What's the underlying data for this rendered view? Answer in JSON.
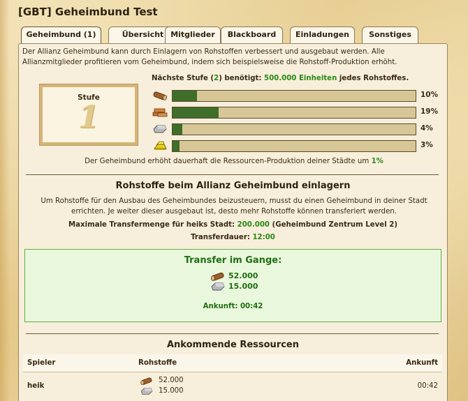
{
  "window": {
    "title": "[GBT] Geheimbund Test"
  },
  "tabs": [
    {
      "label": "Geheimbund (1)",
      "active": true
    },
    {
      "label": "Übersicht"
    },
    {
      "label": "Mitglieder"
    },
    {
      "label": "Blackboard"
    },
    {
      "label": "Einladungen"
    },
    {
      "label": "Sonstiges"
    }
  ],
  "intro": {
    "description": "Der Allianz Geheimbund kann durch Einlagern von Rohstoffen verbessert und ausgebaut werden. Alle Allianzmitglieder profitieren vom Geheimbund, indem sich beispielsweise die Rohstoff-Produktion erhöht."
  },
  "next_level": {
    "prefix": "Nächste Stufe (",
    "level": "2",
    "mid": ") benötigt: ",
    "amount": "500.000 Einheiten",
    "suffix": " jedes Rohstoffes."
  },
  "stufe": {
    "label": "Stufe",
    "value": "1"
  },
  "resources": [
    {
      "icon": "wood-icon",
      "progress": 0.1,
      "percent_label": "10%"
    },
    {
      "icon": "brick-icon",
      "progress": 0.19,
      "percent_label": "19%"
    },
    {
      "icon": "stone-icon",
      "progress": 0.04,
      "percent_label": "4%"
    },
    {
      "icon": "gold-icon",
      "progress": 0.03,
      "percent_label": "3%"
    }
  ],
  "bonus": {
    "prefix": "Der Geheimbund erhöht dauerhaft die Ressourcen-Produktion deiner Städte um ",
    "value": "1%"
  },
  "deposit": {
    "title": "Rohstoffe beim Allianz Geheimbund einlagern",
    "text": "Um Rohstoffe für den Ausbau des Geheimbundes beizusteuern, musst du einen Geheimbund in deiner Stadt errichten. Je weiter dieser ausgebaut ist, desto mehr Rohstoffe können transferiert werden.",
    "max_label": "Maximale Transfermenge für heiks Stadt: ",
    "max_value": "200.000",
    "max_suffix": " (Geheimbund Zentrum Level 2)",
    "duration_label": "Transferdauer: ",
    "duration_value": "12:00"
  },
  "transfer": {
    "title": "Transfer im Gange:",
    "items": [
      {
        "icon": "wood-icon",
        "amount": "52.000"
      },
      {
        "icon": "stone-icon",
        "amount": "15.000"
      }
    ],
    "arrival_label": "Ankunft: ",
    "arrival_value": "00:42"
  },
  "incoming": {
    "title": "Ankommende Ressourcen",
    "headers": {
      "player": "Spieler",
      "resources": "Rohstoffe",
      "arrival": "Ankunft"
    },
    "rows": [
      {
        "player": "heik",
        "resources": [
          {
            "icon": "wood-icon",
            "amount": "52.000"
          },
          {
            "icon": "stone-icon",
            "amount": "15.000"
          }
        ],
        "arrival": "00:42"
      }
    ]
  },
  "colors": {
    "progress_fill": "#3e6e2a",
    "accent_green": "#2a8a14",
    "transfer_bg": "#e9f8dd"
  }
}
